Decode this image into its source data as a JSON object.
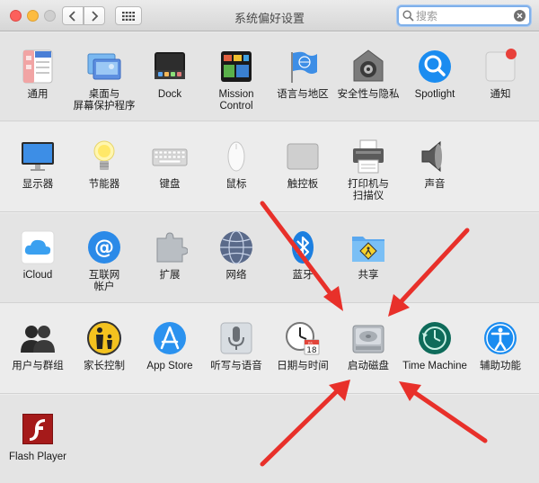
{
  "window": {
    "title": "系统偏好设置"
  },
  "search": {
    "placeholder": "搜索",
    "value": ""
  },
  "rows": [
    {
      "items": [
        {
          "label": "通用",
          "icon": "general-icon"
        },
        {
          "label": "桌面与\n屏幕保护程序",
          "icon": "desktop-screensaver-icon"
        },
        {
          "label": "Dock",
          "icon": "dock-icon"
        },
        {
          "label": "Mission\nControl",
          "icon": "mission-control-icon"
        },
        {
          "label": "语言与地区",
          "icon": "language-region-icon"
        },
        {
          "label": "安全性与隐私",
          "icon": "security-privacy-icon"
        },
        {
          "label": "Spotlight",
          "icon": "spotlight-icon"
        },
        {
          "label": "通知",
          "icon": "notifications-icon"
        }
      ]
    },
    {
      "items": [
        {
          "label": "显示器",
          "icon": "displays-icon"
        },
        {
          "label": "节能器",
          "icon": "energy-saver-icon"
        },
        {
          "label": "键盘",
          "icon": "keyboard-icon"
        },
        {
          "label": "鼠标",
          "icon": "mouse-icon"
        },
        {
          "label": "触控板",
          "icon": "trackpad-icon"
        },
        {
          "label": "打印机与\n扫描仪",
          "icon": "printers-scanners-icon"
        },
        {
          "label": "声音",
          "icon": "sound-icon"
        }
      ]
    },
    {
      "items": [
        {
          "label": "iCloud",
          "icon": "icloud-icon"
        },
        {
          "label": "互联网\n帐户",
          "icon": "internet-accounts-icon"
        },
        {
          "label": "扩展",
          "icon": "extensions-icon"
        },
        {
          "label": "网络",
          "icon": "network-icon"
        },
        {
          "label": "蓝牙",
          "icon": "bluetooth-icon"
        },
        {
          "label": "共享",
          "icon": "sharing-icon"
        }
      ]
    },
    {
      "items": [
        {
          "label": "用户与群组",
          "icon": "users-groups-icon"
        },
        {
          "label": "家长控制",
          "icon": "parental-controls-icon"
        },
        {
          "label": "App Store",
          "icon": "app-store-icon"
        },
        {
          "label": "听写与语音",
          "icon": "dictation-speech-icon"
        },
        {
          "label": "日期与时间",
          "icon": "date-time-icon"
        },
        {
          "label": "启动磁盘",
          "icon": "startup-disk-icon"
        },
        {
          "label": "Time Machine",
          "icon": "time-machine-icon"
        },
        {
          "label": "辅助功能",
          "icon": "accessibility-icon"
        }
      ]
    },
    {
      "items": [
        {
          "label": "Flash Player",
          "icon": "flash-player-icon"
        }
      ]
    }
  ],
  "calendar": {
    "day": "18",
    "month": "JUL"
  },
  "colors": {
    "arrow": "#e8302a",
    "accent_blue": "#1a8cf0",
    "close": "#fc605c",
    "minimize": "#fdbc40"
  }
}
